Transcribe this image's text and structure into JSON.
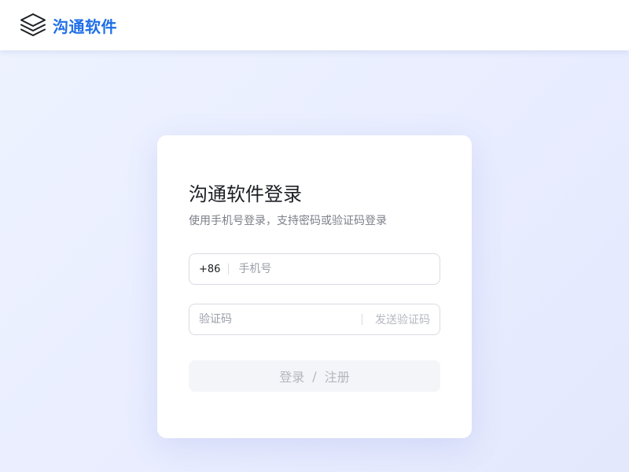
{
  "header": {
    "brand": "沟通软件",
    "logo_icon": "layers-icon",
    "brand_color": "#1f6fe8"
  },
  "login": {
    "title": "沟通软件登录",
    "subtitle": "使用手机号登录，支持密码或验证码登录",
    "phone": {
      "prefix": "+86",
      "placeholder": "手机号",
      "value": ""
    },
    "code": {
      "placeholder": "验证码",
      "value": "",
      "send_label": "发送验证码"
    },
    "submit": {
      "login_label": "登录",
      "separator": "/",
      "register_label": "注册"
    }
  }
}
